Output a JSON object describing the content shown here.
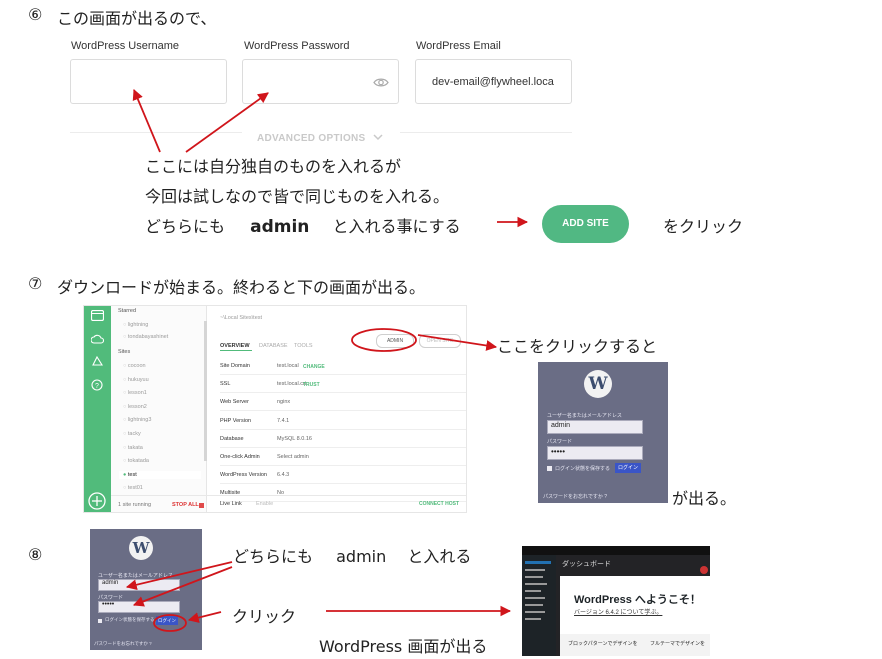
{
  "step6": {
    "number": "⑥",
    "text": "この画面が出るので、",
    "form": {
      "username_label": "WordPress Username",
      "password_label": "WordPress Password",
      "email_label": "WordPress Email",
      "email_value": "dev-email@flywheel.loca",
      "advanced": "ADVANCED OPTIONS"
    },
    "note_line1": "ここには自分独自のものを入れるが",
    "note_line2": "今回は試しなので皆で同じものを入れる。",
    "note_line3_a": "どちらにも",
    "note_line3_b": "admin",
    "note_line3_c": "と入れる事にする",
    "add_site": "ADD SITE",
    "click_text": "をクリック"
  },
  "step7": {
    "number": "⑦",
    "text": "ダウンロードが始まる。終わると下の画面が出る。",
    "app": {
      "starred_label": "Starred",
      "starred": [
        "lightning",
        "tondabayashinet"
      ],
      "sites_label": "Sites",
      "sites": [
        "cocoon",
        "hukuyuu",
        "lesson1",
        "lesson2",
        "lightning3",
        "tacky",
        "takata",
        "tokatada",
        "test",
        "test01"
      ],
      "selected_site": "test",
      "running": "1 site running",
      "stop_all": "STOP ALL",
      "site_path": "~\\Local Sites\\test",
      "tab_overview": "OVERVIEW",
      "tab_database": "DATABASE",
      "tab_tools": "TOOLS",
      "admin_btn": "ADMIN",
      "open_site_btn": "OPEN SITE",
      "rows": [
        {
          "label": "Site Domain",
          "value": "test.local",
          "tag": "CHANGE"
        },
        {
          "label": "SSL",
          "value": "test.local.crt",
          "tag": "TRUST"
        },
        {
          "label": "Web Server",
          "value": "nginx",
          "tag": ""
        },
        {
          "label": "PHP Version",
          "value": "7.4.1",
          "tag": ""
        },
        {
          "label": "Database",
          "value": "MySQL 8.0.16",
          "tag": ""
        },
        {
          "label": "One-click Admin",
          "value": "Select admin",
          "tag": ""
        },
        {
          "label": "WordPress Version",
          "value": "6.4.3",
          "tag": ""
        },
        {
          "label": "Multisite",
          "value": "No",
          "tag": ""
        }
      ],
      "live_link": "Live Link",
      "enable": "Enable",
      "connect_host": "CONNECT HOST"
    },
    "click_note": "ここをクリックすると",
    "appears": "が出る。"
  },
  "login": {
    "user_label": "ユーザー名またはメールアドレス",
    "user_value": "admin",
    "pass_label": "パスワード",
    "pass_value": "•••••",
    "remember": "ログイン状態を保存する",
    "login_btn": "ログイン",
    "lost": "パスワードをお忘れですか ?"
  },
  "step8": {
    "number": "⑧",
    "note1_a": "どちらにも",
    "note1_b": "admin",
    "note1_c": "と入れる",
    "click": "クリック",
    "result": "WordPress 画面が出る",
    "dash_title": "ダッシュボード",
    "welcome": "WordPress へようこそ！",
    "welcome_sub": "バージョン 6.4.2 について学ぶ。",
    "block_text": "ブロックパターンでデザインを",
    "block_text2": "フルテーマでデザインを"
  },
  "colors": {
    "green": "#51bb7b",
    "arrow": "#d0151b"
  }
}
